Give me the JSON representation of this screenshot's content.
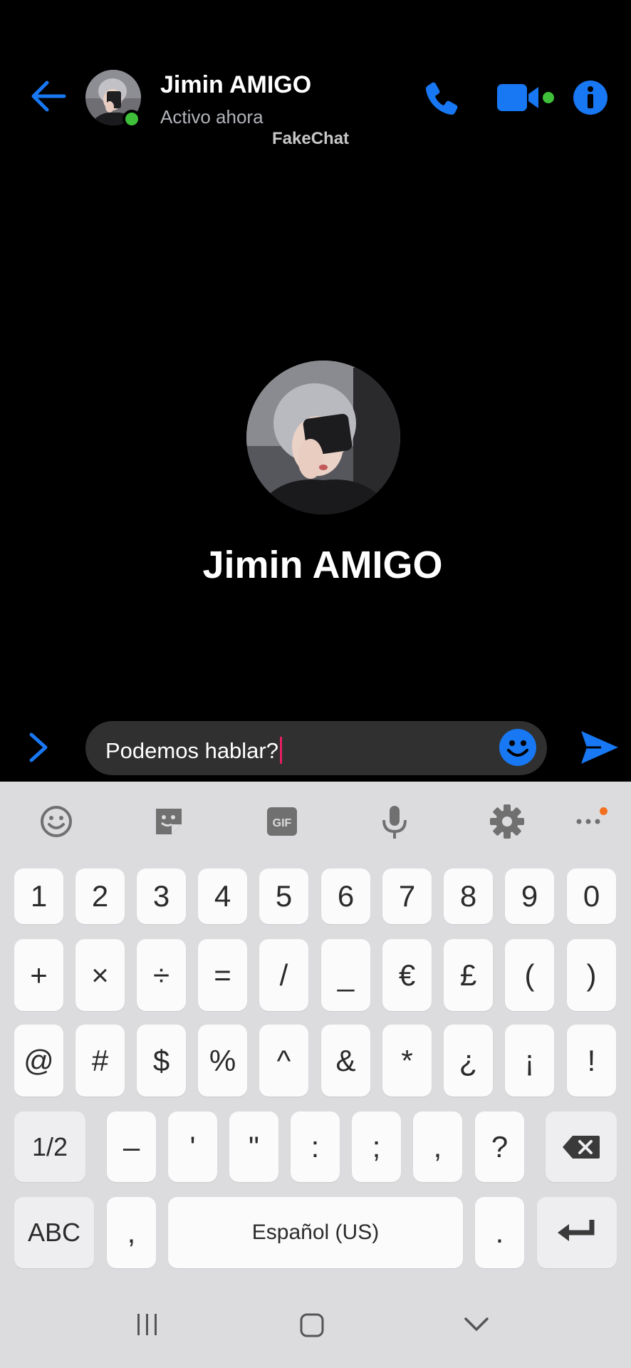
{
  "header": {
    "contact_name": "Jimin AMIGO",
    "status": "Activo ahora",
    "watermark": "FakeChat"
  },
  "profile": {
    "name": "Jimin AMIGO"
  },
  "composer": {
    "message_text": "Podemos hablar?"
  },
  "keyboard": {
    "toolbar_icons": [
      "emoji-icon",
      "sticker-icon",
      "gif-icon",
      "microphone-icon",
      "settings-icon",
      "more-icon"
    ],
    "gif_label": "GIF",
    "row1": [
      "1",
      "2",
      "3",
      "4",
      "5",
      "6",
      "7",
      "8",
      "9",
      "0"
    ],
    "row2": [
      "+",
      "×",
      "÷",
      "=",
      "/",
      "_",
      "€",
      "£",
      "(",
      ")"
    ],
    "row3": [
      "@",
      "#",
      "$",
      "%",
      "^",
      "&",
      "*",
      "¿",
      "¡",
      "!"
    ],
    "row4": {
      "toggle_label": "1/2",
      "keys": [
        "–",
        "'",
        "\"",
        ":",
        ";",
        ",",
        "?"
      ]
    },
    "row5": {
      "abc_label": "ABC",
      "comma_label": ",",
      "space_label": "Español (US)",
      "period_label": "."
    }
  },
  "colors": {
    "accent": "#1877f2",
    "online": "#3fbf3a",
    "background": "#000000",
    "keyboard_bg": "#dcdcde",
    "caret": "#e91e63"
  }
}
